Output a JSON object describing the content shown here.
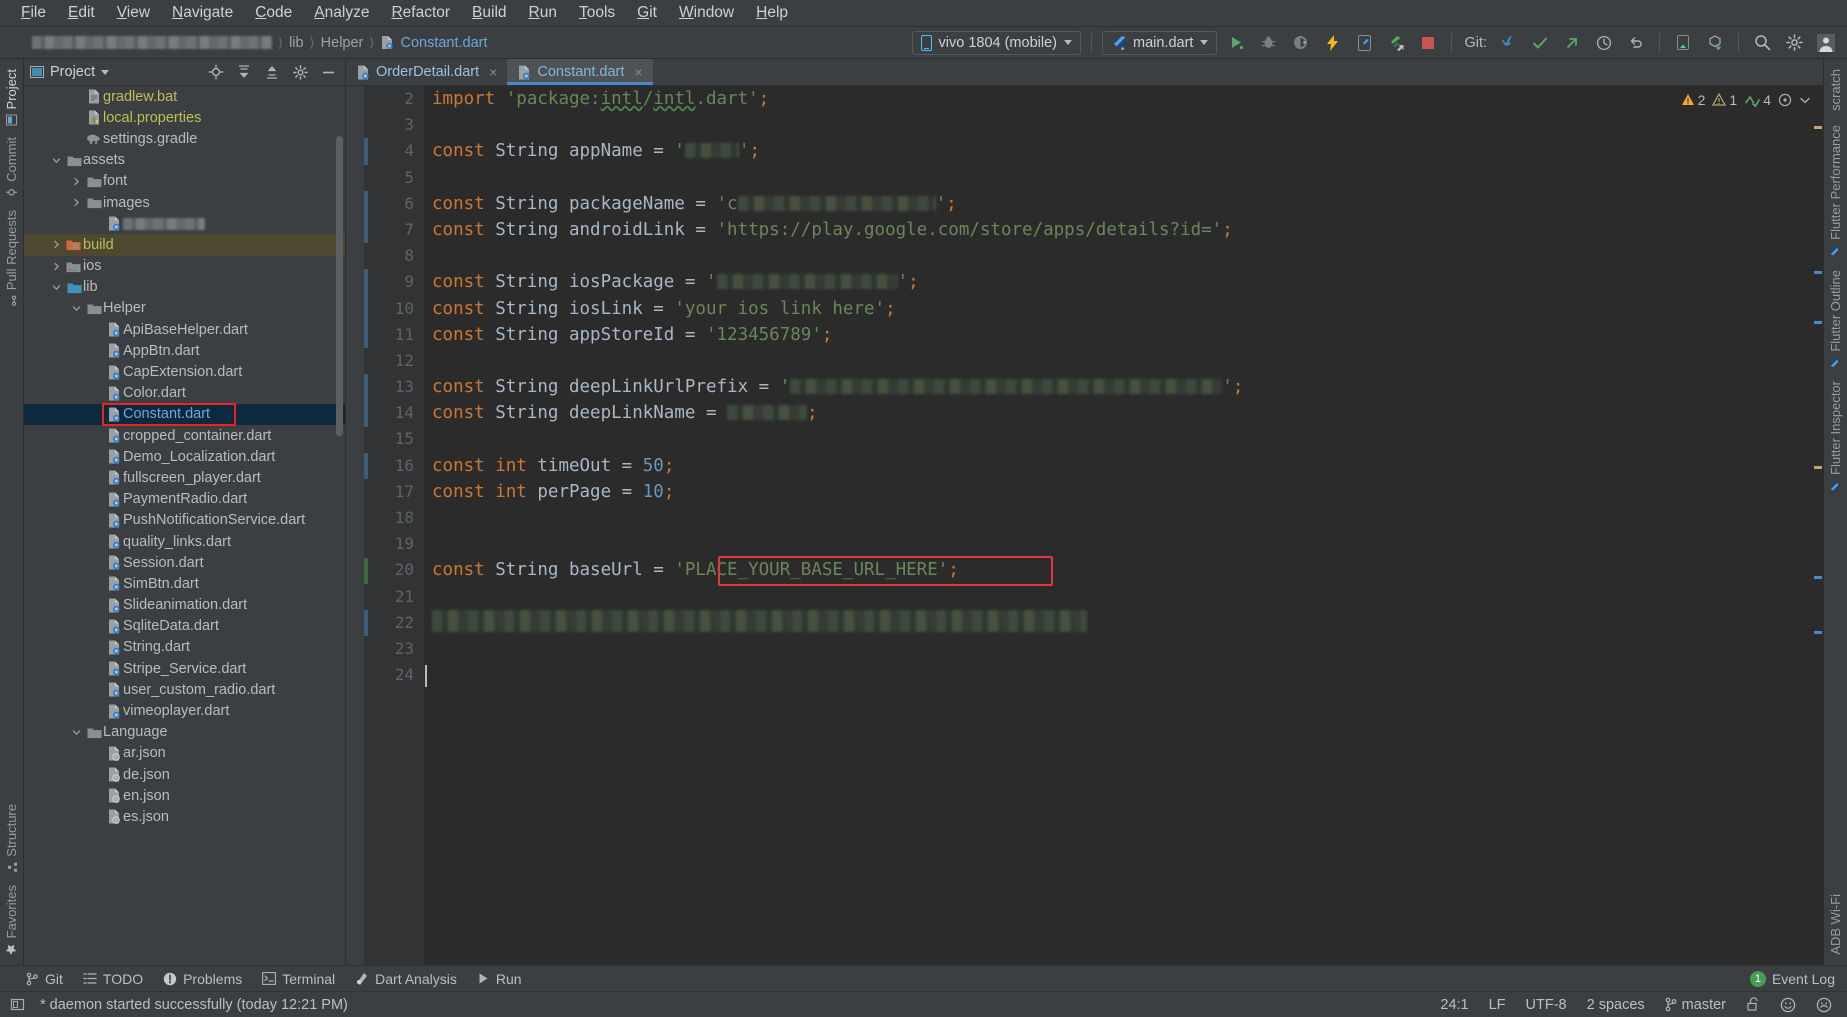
{
  "menu": {
    "items": [
      "File",
      "Edit",
      "View",
      "Navigate",
      "Code",
      "Analyze",
      "Refactor",
      "Build",
      "Run",
      "Tools",
      "Git",
      "Window",
      "Help"
    ]
  },
  "toolbar": {
    "breadcrumb_project_redacted": "",
    "breadcrumb": [
      "lib",
      "Helper"
    ],
    "breadcrumb_file": "Constant.dart",
    "device_selector": "vivo 1804 (mobile)",
    "run_config": "main.dart",
    "git_label": "Git:",
    "icons": [
      "run-icon",
      "debug-icon",
      "profile-icon",
      "flash-hot-reload-icon",
      "device-manager-icon",
      "flutter-attach-icon",
      "stop-icon",
      "git-update-icon",
      "git-commit-icon",
      "git-push-icon",
      "history-icon",
      "undo-icon",
      "device-file-explorer-icon",
      "sdk-download-icon",
      "search-everywhere-icon",
      "settings-icon",
      "account-icon"
    ]
  },
  "left_strip": {
    "top_tabs": [
      "Project",
      "Commit",
      "Pull Requests"
    ],
    "bottom_tabs": [
      "Structure",
      "Favorites"
    ]
  },
  "right_strip": {
    "tabs": [
      "scratch",
      "Flutter Performance",
      "Flutter Outline",
      "Flutter Inspector",
      "ADB Wi-Fi"
    ]
  },
  "project_panel": {
    "title": "Project",
    "header_icons": [
      "locate-icon",
      "expand-all-icon",
      "collapse-all-icon",
      "gear-icon",
      "hide-icon"
    ],
    "tree": [
      {
        "indent": 2,
        "arrow": "",
        "icon": "gradle-file-icon",
        "label": "gradlew.bat",
        "color": "gold"
      },
      {
        "indent": 2,
        "arrow": "",
        "icon": "properties-file-icon",
        "label": "local.properties",
        "color": "gold"
      },
      {
        "indent": 2,
        "arrow": "",
        "icon": "gradle-elephant-icon",
        "label": "settings.gradle",
        "color": "normal"
      },
      {
        "indent": 1,
        "arrow": "down",
        "icon": "folder-icon",
        "label": "assets",
        "color": "normal"
      },
      {
        "indent": 2,
        "arrow": "right",
        "icon": "folder-icon",
        "label": "font",
        "color": "normal"
      },
      {
        "indent": 2,
        "arrow": "right",
        "icon": "folder-icon",
        "label": "images",
        "color": "normal"
      },
      {
        "indent": 3,
        "arrow": "",
        "icon": "dart-file-icon",
        "label": "",
        "color": "redacted"
      },
      {
        "indent": 1,
        "arrow": "right",
        "icon": "build-folder-icon",
        "label": "build",
        "color": "gold",
        "row": "build"
      },
      {
        "indent": 1,
        "arrow": "right",
        "icon": "ios-folder-icon",
        "label": "ios",
        "color": "normal"
      },
      {
        "indent": 1,
        "arrow": "down",
        "icon": "lib-folder-icon",
        "label": "lib",
        "color": "normal"
      },
      {
        "indent": 2,
        "arrow": "down",
        "icon": "folder-icon",
        "label": "Helper",
        "color": "normal"
      },
      {
        "indent": 3,
        "arrow": "",
        "icon": "dart-file-icon",
        "label": "ApiBaseHelper.dart",
        "color": "normal"
      },
      {
        "indent": 3,
        "arrow": "",
        "icon": "dart-file-icon",
        "label": "AppBtn.dart",
        "color": "normal"
      },
      {
        "indent": 3,
        "arrow": "",
        "icon": "dart-file-icon",
        "label": "CapExtension.dart",
        "color": "normal"
      },
      {
        "indent": 3,
        "arrow": "",
        "icon": "dart-file-icon",
        "label": "Color.dart",
        "color": "normal"
      },
      {
        "indent": 3,
        "arrow": "",
        "icon": "dart-file-icon",
        "label": "Constant.dart",
        "color": "blue",
        "selected": true,
        "highlighted": true
      },
      {
        "indent": 3,
        "arrow": "",
        "icon": "dart-file-icon",
        "label": "cropped_container.dart",
        "color": "normal"
      },
      {
        "indent": 3,
        "arrow": "",
        "icon": "dart-file-icon",
        "label": "Demo_Localization.dart",
        "color": "normal"
      },
      {
        "indent": 3,
        "arrow": "",
        "icon": "dart-file-icon",
        "label": "fullscreen_player.dart",
        "color": "normal"
      },
      {
        "indent": 3,
        "arrow": "",
        "icon": "dart-file-icon",
        "label": "PaymentRadio.dart",
        "color": "normal"
      },
      {
        "indent": 3,
        "arrow": "",
        "icon": "dart-file-icon",
        "label": "PushNotificationService.dart",
        "color": "normal"
      },
      {
        "indent": 3,
        "arrow": "",
        "icon": "dart-file-icon",
        "label": "quality_links.dart",
        "color": "normal"
      },
      {
        "indent": 3,
        "arrow": "",
        "icon": "dart-file-icon",
        "label": "Session.dart",
        "color": "normal"
      },
      {
        "indent": 3,
        "arrow": "",
        "icon": "dart-file-icon",
        "label": "SimBtn.dart",
        "color": "normal"
      },
      {
        "indent": 3,
        "arrow": "",
        "icon": "dart-file-icon",
        "label": "Slideanimation.dart",
        "color": "normal"
      },
      {
        "indent": 3,
        "arrow": "",
        "icon": "dart-file-icon",
        "label": "SqliteData.dart",
        "color": "normal"
      },
      {
        "indent": 3,
        "arrow": "",
        "icon": "dart-file-icon",
        "label": "String.dart",
        "color": "normal"
      },
      {
        "indent": 3,
        "arrow": "",
        "icon": "dart-file-icon",
        "label": "Stripe_Service.dart",
        "color": "normal"
      },
      {
        "indent": 3,
        "arrow": "",
        "icon": "dart-file-icon",
        "label": "user_custom_radio.dart",
        "color": "normal"
      },
      {
        "indent": 3,
        "arrow": "",
        "icon": "dart-file-icon",
        "label": "vimeoplayer.dart",
        "color": "normal"
      },
      {
        "indent": 2,
        "arrow": "down",
        "icon": "folder-icon",
        "label": "Language",
        "color": "normal"
      },
      {
        "indent": 3,
        "arrow": "",
        "icon": "json-file-icon",
        "label": "ar.json",
        "color": "normal"
      },
      {
        "indent": 3,
        "arrow": "",
        "icon": "json-file-icon",
        "label": "de.json",
        "color": "normal"
      },
      {
        "indent": 3,
        "arrow": "",
        "icon": "json-file-icon",
        "label": "en.json",
        "color": "normal"
      },
      {
        "indent": 3,
        "arrow": "",
        "icon": "json-file-icon",
        "label": "es.json",
        "color": "normal"
      }
    ]
  },
  "editor": {
    "tabs": [
      {
        "label": "OrderDetail.dart",
        "active": false
      },
      {
        "label": "Constant.dart",
        "active": true
      }
    ],
    "inspections": {
      "warnings": "2",
      "weak_warnings": "1",
      "typos": "4"
    },
    "lines": [
      {
        "n": "2",
        "tokens": [
          {
            "t": "kw",
            "v": "import"
          },
          {
            "t": "op",
            "v": " "
          },
          {
            "t": "str",
            "v": "'package:"
          },
          {
            "t": "squig",
            "v": "intl"
          },
          {
            "t": "str",
            "v": "/"
          },
          {
            "t": "squig",
            "v": "intl"
          },
          {
            "t": "str",
            "v": ".dart'"
          },
          {
            "t": "semi",
            "v": ";"
          }
        ],
        "fold": true
      },
      {
        "n": "3",
        "tokens": []
      },
      {
        "n": "4",
        "tokens": [
          {
            "t": "kw",
            "v": "const"
          },
          {
            "t": "op",
            "v": " "
          },
          {
            "t": "ty",
            "v": "String"
          },
          {
            "t": "op",
            "v": " appName = "
          },
          {
            "t": "str",
            "v": "'"
          },
          {
            "t": "blob",
            "v": "54"
          },
          {
            "t": "str",
            "v": "'"
          },
          {
            "t": "semi",
            "v": ";"
          }
        ],
        "change": "blue"
      },
      {
        "n": "5",
        "tokens": []
      },
      {
        "n": "6",
        "tokens": [
          {
            "t": "kw",
            "v": "const"
          },
          {
            "t": "op",
            "v": " "
          },
          {
            "t": "ty",
            "v": "String"
          },
          {
            "t": "op",
            "v": " packageName = "
          },
          {
            "t": "str",
            "v": "'c"
          },
          {
            "t": "blob",
            "v": "198"
          },
          {
            "t": "str",
            "v": "'"
          },
          {
            "t": "semi",
            "v": ";"
          }
        ],
        "change": "blue"
      },
      {
        "n": "7",
        "tokens": [
          {
            "t": "kw",
            "v": "const"
          },
          {
            "t": "op",
            "v": " "
          },
          {
            "t": "ty",
            "v": "String"
          },
          {
            "t": "op",
            "v": " androidLink = "
          },
          {
            "t": "str",
            "v": "'https://play.google.com/store/apps/details?id='"
          },
          {
            "t": "semi",
            "v": ";"
          }
        ],
        "change": "blue"
      },
      {
        "n": "8",
        "tokens": []
      },
      {
        "n": "9",
        "tokens": [
          {
            "t": "kw",
            "v": "const"
          },
          {
            "t": "op",
            "v": " "
          },
          {
            "t": "ty",
            "v": "String"
          },
          {
            "t": "op",
            "v": " iosPackage = "
          },
          {
            "t": "str",
            "v": "'"
          },
          {
            "t": "blob",
            "v": "181"
          },
          {
            "t": "str",
            "v": "'"
          },
          {
            "t": "semi",
            "v": ";"
          }
        ],
        "change": "blue"
      },
      {
        "n": "10",
        "tokens": [
          {
            "t": "kw",
            "v": "const"
          },
          {
            "t": "op",
            "v": " "
          },
          {
            "t": "ty",
            "v": "String"
          },
          {
            "t": "op",
            "v": " iosLink = "
          },
          {
            "t": "str",
            "v": "'your ios link here'"
          },
          {
            "t": "semi",
            "v": ";"
          }
        ],
        "change": "blue"
      },
      {
        "n": "11",
        "tokens": [
          {
            "t": "kw",
            "v": "const"
          },
          {
            "t": "op",
            "v": " "
          },
          {
            "t": "ty",
            "v": "String"
          },
          {
            "t": "op",
            "v": " appStoreId = "
          },
          {
            "t": "str",
            "v": "'123456789'"
          },
          {
            "t": "semi",
            "v": ";"
          }
        ],
        "change": "blue"
      },
      {
        "n": "12",
        "tokens": []
      },
      {
        "n": "13",
        "tokens": [
          {
            "t": "kw",
            "v": "const"
          },
          {
            "t": "op",
            "v": " "
          },
          {
            "t": "ty",
            "v": "String"
          },
          {
            "t": "op",
            "v": " deepLinkUrlPrefix = "
          },
          {
            "t": "str",
            "v": "'"
          },
          {
            "t": "blob",
            "v": "432"
          },
          {
            "t": "str",
            "v": "'"
          },
          {
            "t": "semi",
            "v": ";"
          }
        ],
        "change": "blue"
      },
      {
        "n": "14",
        "tokens": [
          {
            "t": "kw",
            "v": "const"
          },
          {
            "t": "op",
            "v": " "
          },
          {
            "t": "ty",
            "v": "String"
          },
          {
            "t": "op",
            "v": " deepLinkName = "
          },
          {
            "t": "blob",
            "v": "80"
          },
          {
            "t": "semi",
            "v": ";"
          }
        ],
        "change": "blue"
      },
      {
        "n": "15",
        "tokens": []
      },
      {
        "n": "16",
        "tokens": [
          {
            "t": "kw",
            "v": "const"
          },
          {
            "t": "op",
            "v": " "
          },
          {
            "t": "kw",
            "v": "int"
          },
          {
            "t": "op",
            "v": " timeOut = "
          },
          {
            "t": "num",
            "v": "50"
          },
          {
            "t": "semi",
            "v": ";"
          }
        ],
        "change": "blue"
      },
      {
        "n": "17",
        "tokens": [
          {
            "t": "kw",
            "v": "const"
          },
          {
            "t": "op",
            "v": " "
          },
          {
            "t": "kw",
            "v": "int"
          },
          {
            "t": "op",
            "v": " perPage = "
          },
          {
            "t": "num",
            "v": "10"
          },
          {
            "t": "semi",
            "v": ";"
          }
        ]
      },
      {
        "n": "18",
        "tokens": [],
        "gutter_marker": "run-gutter-icon"
      },
      {
        "n": "19",
        "tokens": []
      },
      {
        "n": "20",
        "tokens": [
          {
            "t": "kw",
            "v": "const"
          },
          {
            "t": "op",
            "v": " "
          },
          {
            "t": "ty",
            "v": "String"
          },
          {
            "t": "op",
            "v": " baseUrl = "
          },
          {
            "t": "str",
            "v": "'PLACE_YOUR_BASE_URL_HERE'"
          },
          {
            "t": "semi",
            "v": ";"
          }
        ],
        "change": "green",
        "highlighted_value": true
      },
      {
        "n": "21",
        "tokens": []
      },
      {
        "n": "22",
        "tokens": [],
        "change": "blue",
        "blurred_block": true
      },
      {
        "n": "23",
        "tokens": []
      },
      {
        "n": "24",
        "tokens": [],
        "caret": true
      }
    ]
  },
  "bottom_bar": {
    "items": [
      {
        "label": "Git",
        "icon": "git-branch-icon"
      },
      {
        "label": "TODO",
        "icon": "todo-icon"
      },
      {
        "label": "Problems",
        "icon": "problems-icon"
      },
      {
        "label": "Terminal",
        "icon": "terminal-icon"
      },
      {
        "label": "Dart Analysis",
        "icon": "dart-icon"
      },
      {
        "label": "Run",
        "icon": "run-icon"
      }
    ],
    "event_log": {
      "label": "Event Log",
      "count": "1"
    }
  },
  "status_bar": {
    "message_icon": "message-icon",
    "message": "* daemon started successfully (today 12:21 PM)",
    "caret_position": "24:1",
    "line_separator": "LF",
    "encoding": "UTF-8",
    "indent": "2 spaces",
    "branch": "master",
    "branch_icon": "git-branch-icon",
    "lock_icon": "unlocked-icon",
    "faces": [
      "happy-face-icon",
      "sad-face-icon"
    ]
  },
  "colors": {
    "accent_blue": "#4a88c7",
    "selection": "#0d293e",
    "highlight_red": "#ee2222",
    "string_green": "#6a8759",
    "keyword_orange": "#cc7832",
    "number_blue": "#6897bb",
    "panel_bg": "#3c3f41",
    "editor_bg": "#2b2b2b"
  }
}
